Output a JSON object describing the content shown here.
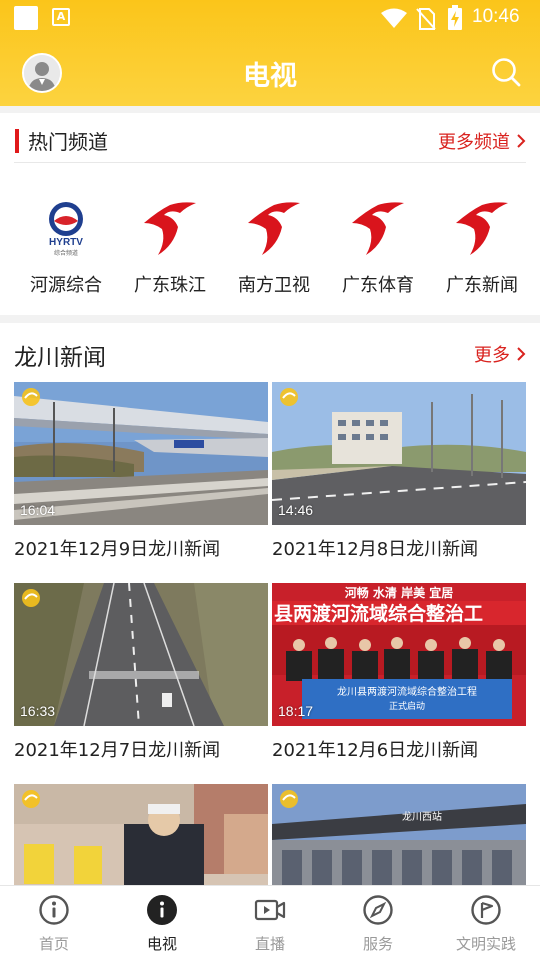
{
  "status_bar": {
    "time": "10:46"
  },
  "header": {
    "title": "电视"
  },
  "hot_channels": {
    "title": "热门频道",
    "more_label": "更多频道",
    "items": [
      {
        "name": "河源综合",
        "icon": "hyrtv-logo",
        "logo_text": "HYRTV",
        "logo_sub": "综合频道"
      },
      {
        "name": "广东珠江",
        "icon": "gdtv-logo"
      },
      {
        "name": "南方卫视",
        "icon": "gdtv-logo"
      },
      {
        "name": "广东体育",
        "icon": "gdtv-logo"
      },
      {
        "name": "广东新闻",
        "icon": "gdtv-logo"
      }
    ]
  },
  "news": {
    "title": "龙川新闻",
    "more_label": "更多",
    "items": [
      {
        "title": "2021年12月9日龙川新闻",
        "duration": "16:04",
        "thumb": "railway-station"
      },
      {
        "title": "2021年12月8日龙川新闻",
        "duration": "14:46",
        "thumb": "new-road"
      },
      {
        "title": "2021年12月7日龙川新闻",
        "duration": "16:33",
        "thumb": "highway"
      },
      {
        "title": "2021年12月6日龙川新闻",
        "duration": "18:17",
        "thumb": "ceremony",
        "banner_text": "县两渡河流域综合整治工",
        "top_text": "河畅 水清 岸美 宜居",
        "board_text": "龙川县两渡河流域综合整治工程",
        "board_sub": "正式启动"
      },
      {
        "title": "",
        "duration": "",
        "thumb": "traffic-police"
      },
      {
        "title": "",
        "duration": "",
        "thumb": "station-building",
        "sign_text": "龙川西站"
      }
    ]
  },
  "bottom_nav": {
    "items": [
      {
        "label": "首页",
        "icon": "info-icon",
        "active": false
      },
      {
        "label": "电视",
        "icon": "info-icon",
        "active": true
      },
      {
        "label": "直播",
        "icon": "video-camera-icon",
        "active": false
      },
      {
        "label": "服务",
        "icon": "compass-icon",
        "active": false
      },
      {
        "label": "文明实践",
        "icon": "flag-icon",
        "active": false
      }
    ]
  },
  "colors": {
    "header": "#fbc51a",
    "accent_red": "#e0191a",
    "more_red": "#d9231f"
  }
}
